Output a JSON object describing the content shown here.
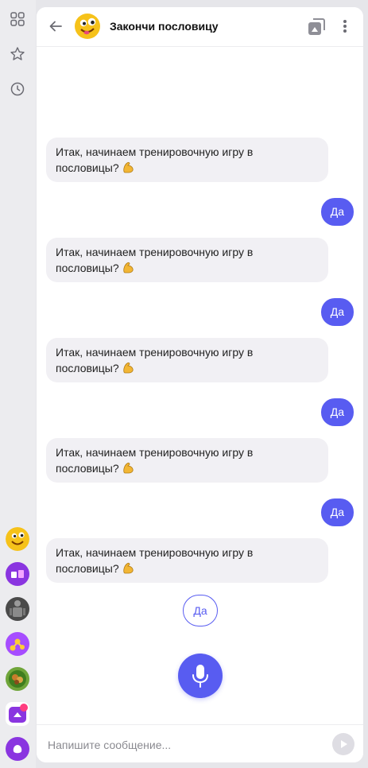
{
  "sidebar": {
    "icons": [
      "grid-icon",
      "star-icon",
      "clock-icon"
    ],
    "apps": [
      "proverbs-skill",
      "games-skill",
      "robot-skill",
      "molecules-skill",
      "forest-skill",
      "home-skill",
      "alice-assistant"
    ]
  },
  "header": {
    "title": "Закончи пословицу",
    "icons": [
      "back-arrow-icon",
      "device-house-icon",
      "more-vertical-icon"
    ]
  },
  "messages": [
    {
      "from": "alice",
      "text": "Итак, начинаем тренировочную игру в пословицы?"
    },
    {
      "from": "user",
      "text": "Да"
    },
    {
      "from": "alice",
      "text": "Итак, начинаем тренировочную игру в пословицы?"
    },
    {
      "from": "user",
      "text": "Да"
    },
    {
      "from": "alice",
      "text": "Итак, начинаем тренировочную игру в пословицы?"
    },
    {
      "from": "user",
      "text": "Да"
    },
    {
      "from": "alice",
      "text": "Итак, начинаем тренировочную игру в пословицы?"
    },
    {
      "from": "user",
      "text": "Да"
    },
    {
      "from": "alice",
      "text": "Итак, начинаем тренировочную игру в пословицы?"
    }
  ],
  "suggestion": "Да",
  "composer": {
    "placeholder": "Напишите сообщение..."
  },
  "colors": {
    "accent": "#585cf1",
    "incoming_bubble": "#f1f0f4",
    "rail_bg": "#ececef"
  }
}
